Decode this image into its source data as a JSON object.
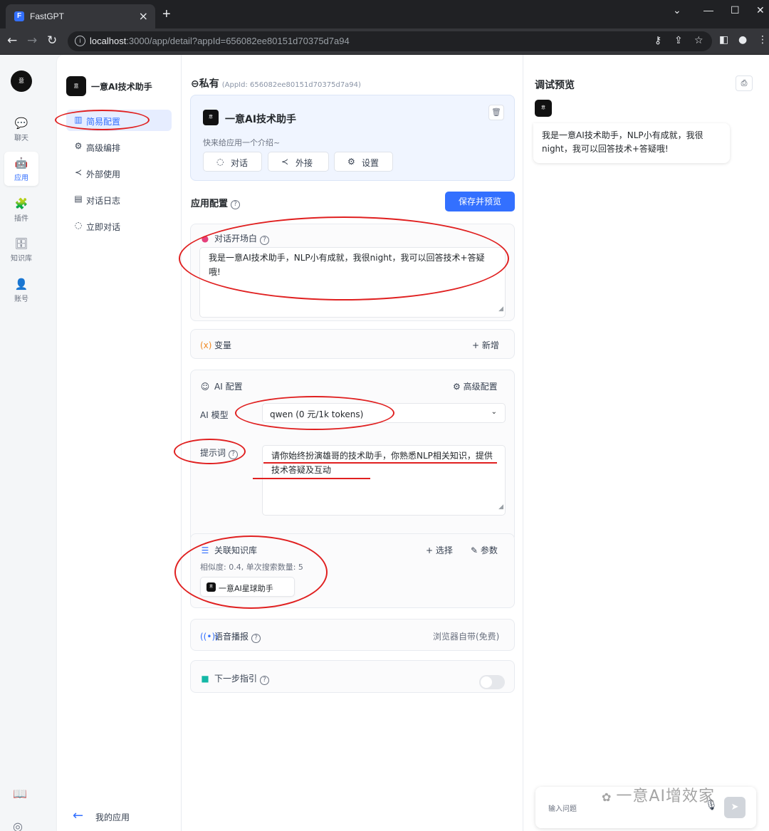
{
  "browser": {
    "tab_title": "FastGPT",
    "tab_close": "×",
    "new_tab": "+",
    "url_host": "localhost",
    "url_rest": ":3000/app/detail?appId=656082ee80151d70375d7a94"
  },
  "app_nav": {
    "items": [
      {
        "label": "聊天",
        "icon": "chat-icon"
      },
      {
        "label": "应用",
        "icon": "robot-icon"
      },
      {
        "label": "插件",
        "icon": "puzzle-icon"
      },
      {
        "label": "知识库",
        "icon": "database-icon"
      },
      {
        "label": "账号",
        "icon": "user-icon"
      }
    ],
    "active": "应用"
  },
  "menu": {
    "app_name": "一意AI技术助手",
    "items": [
      {
        "label": "简易配置",
        "icon": "chart-icon"
      },
      {
        "label": "高级编排",
        "icon": "gear-icon"
      },
      {
        "label": "外部使用",
        "icon": "share-icon"
      },
      {
        "label": "对话日志",
        "icon": "log-icon"
      },
      {
        "label": "立即对话",
        "icon": "chat-icon"
      }
    ],
    "back_label": "我的应用"
  },
  "center": {
    "section_title": "私有",
    "app_id_label": "(AppId: 656082ee80151d70375d7a94)",
    "card": {
      "name": "一意AI技术助手",
      "intro": "快来给应用一个介绍~",
      "buttons": [
        "对话",
        "外接",
        "设置"
      ]
    },
    "config_title": "应用配置",
    "save_label": "保存并预览",
    "welcome": {
      "title": "对话开场白",
      "text": "我是一意AI技术助手，NLP小有成就，我很night，我可以回答技术+答疑哦!"
    },
    "variables": {
      "title": "变量",
      "add_label": "+ 新增"
    },
    "ai": {
      "title": "AI 配置",
      "advanced_label": "高级配置",
      "model_label": "AI 模型",
      "model_value": "qwen (0 元/1k tokens)",
      "prompt_label": "提示词",
      "prompt_text": "请你始终扮演雄哥的技术助手，你熟悉NLP相关知识，提供技术答疑及互动"
    },
    "knowledge": {
      "title": "关联知识库",
      "select_label": "+ 选择",
      "params_label": "参数",
      "meta": "相似度: 0.4, 单次搜索数量: 5",
      "chip": "一意AI星球助手"
    },
    "tts": {
      "title": "语音播报",
      "value": "浏览器自带(免费)"
    },
    "next_guide": {
      "title": "下一步指引",
      "enabled": false
    }
  },
  "preview": {
    "title": "调试预览",
    "bubble": "我是一意AI技术助手，NLP小有成就，我很night，我可以回答技术+答疑哦!",
    "input_placeholder": "输入问题"
  },
  "watermark": "一意AI增效家",
  "colors": {
    "accent": "#3370ff",
    "annotation": "#e02020"
  }
}
